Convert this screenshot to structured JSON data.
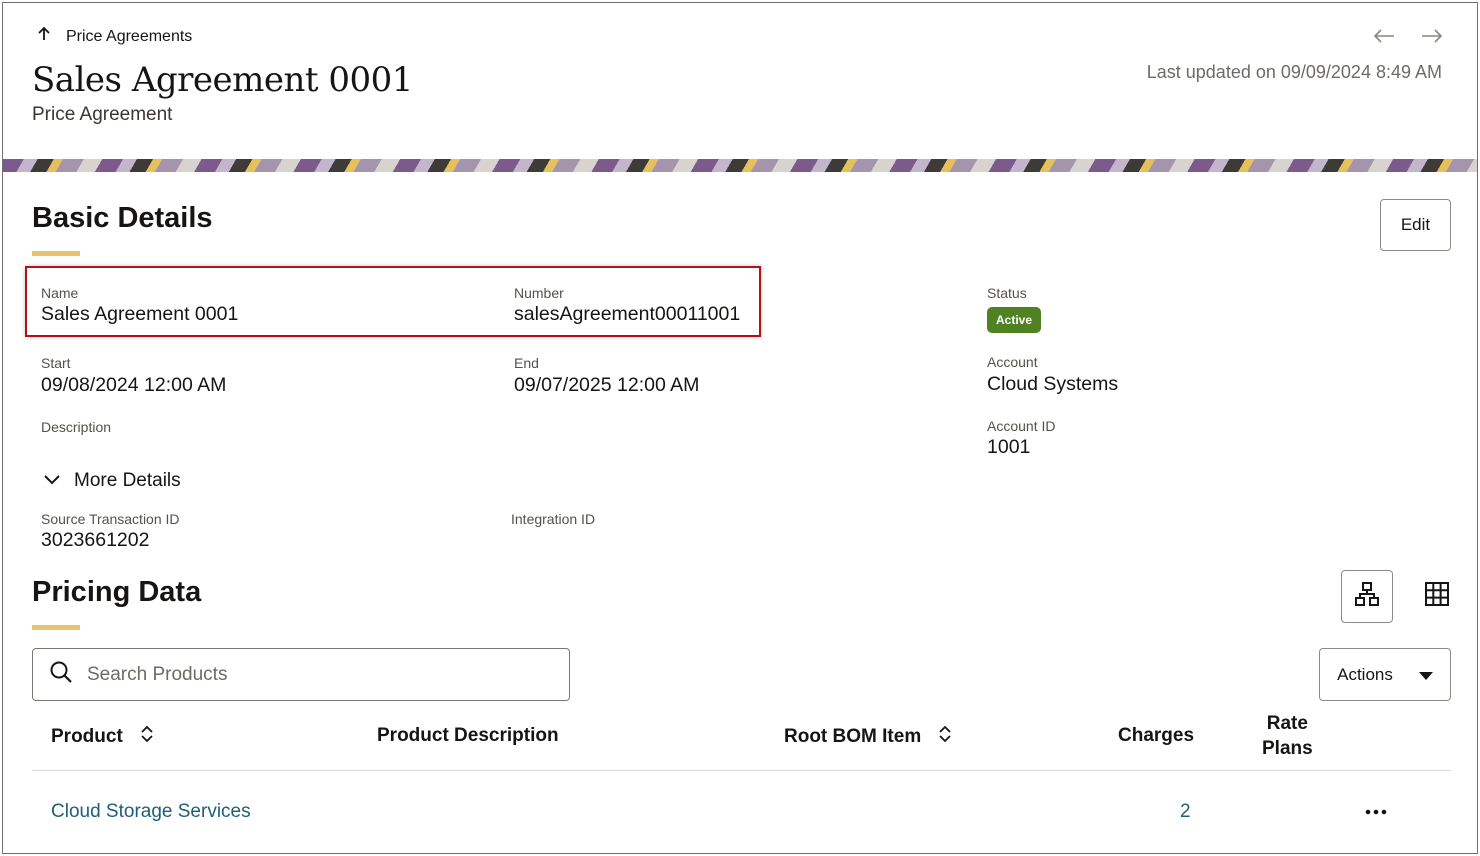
{
  "header": {
    "back_label": "Price Agreements",
    "title": "Sales Agreement 0001",
    "subtitle": "Price Agreement",
    "last_updated": "Last updated on 09/09/2024 8:49 AM"
  },
  "basic_details": {
    "title": "Basic Details",
    "edit_label": "Edit",
    "fields": {
      "name_label": "Name",
      "name_value": "Sales Agreement 0001",
      "number_label": "Number",
      "number_value": "salesAgreement00011001",
      "status_label": "Status",
      "status_value": "Active",
      "start_label": "Start",
      "start_value": "09/08/2024 12:00 AM",
      "end_label": "End",
      "end_value": "09/07/2025 12:00 AM",
      "account_label": "Account",
      "account_value": "Cloud Systems",
      "description_label": "Description",
      "account_id_label": "Account ID",
      "account_id_value": "1001"
    },
    "more_details_label": "More Details",
    "more_fields": {
      "source_tx_label": "Source Transaction ID",
      "source_tx_value": "3023661202",
      "integration_label": "Integration ID"
    }
  },
  "pricing_data": {
    "title": "Pricing Data",
    "search_placeholder": "Search Products",
    "actions_label": "Actions",
    "columns": {
      "product": "Product",
      "description": "Product Description",
      "root_bom": "Root BOM Item",
      "charges": "Charges",
      "rate_plans_line1": "Rate",
      "rate_plans_line2": "Plans"
    },
    "rows": [
      {
        "product": "Cloud Storage Services",
        "description": "",
        "root_bom": "",
        "charges": "2"
      }
    ]
  },
  "colors": {
    "accent_bar": "#e8c36b",
    "status_active": "#508223",
    "link": "#1f5e7a",
    "highlight": "#b4121b"
  },
  "icons": {
    "back": "arrow-up-icon",
    "prev": "arrow-left-icon",
    "next": "arrow-right-icon",
    "expand": "chevron-down-icon",
    "hierarchy_view": "hierarchy-icon",
    "table_view": "grid-icon",
    "search": "search-icon",
    "actions_caret": "caret-down-icon",
    "sort": "sort-icon",
    "row_menu": "more-horizontal-icon"
  }
}
